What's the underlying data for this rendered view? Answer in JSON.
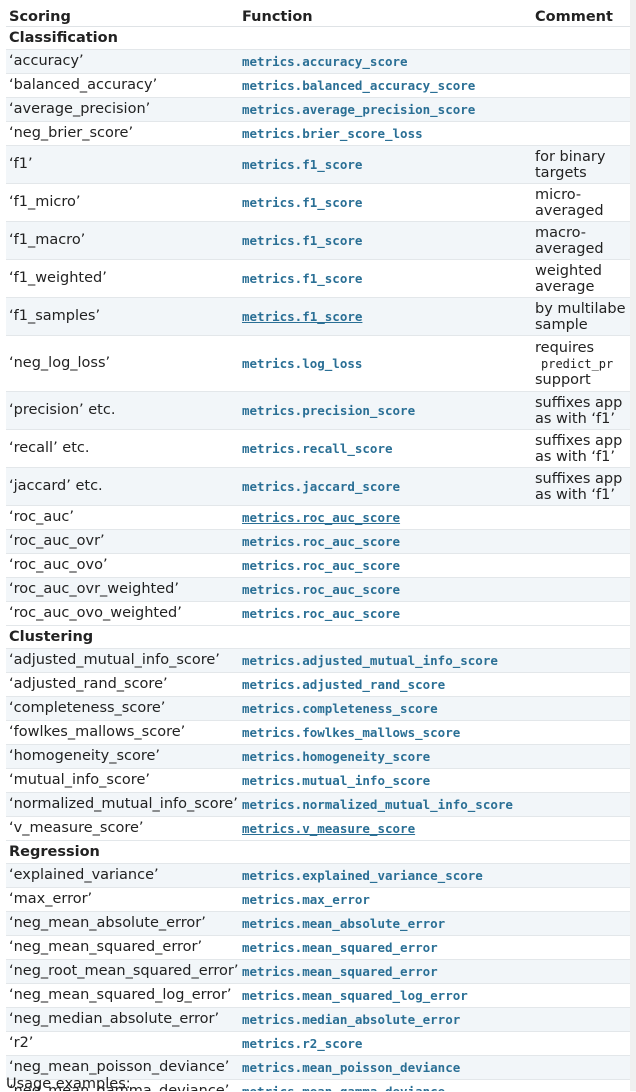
{
  "headers": {
    "scoring": "Scoring",
    "function": "Function",
    "comment": "Comment"
  },
  "sections": [
    {
      "title": "Classification",
      "rows": [
        {
          "scoring": "‘accuracy’",
          "function": "metrics.accuracy_score"
        },
        {
          "scoring": "‘balanced_accuracy’",
          "function": "metrics.balanced_accuracy_score"
        },
        {
          "scoring": "‘average_precision’",
          "function": "metrics.average_precision_score"
        },
        {
          "scoring": "‘neg_brier_score’",
          "function": "metrics.brier_score_loss"
        },
        {
          "scoring": "‘f1’",
          "function": "metrics.f1_score",
          "comment": [
            "for binary",
            "targets"
          ]
        },
        {
          "scoring": "‘f1_micro’",
          "function": "metrics.f1_score",
          "comment": [
            "micro-",
            "averaged"
          ]
        },
        {
          "scoring": "‘f1_macro’",
          "function": "metrics.f1_score",
          "comment": [
            "macro-",
            "averaged"
          ]
        },
        {
          "scoring": "‘f1_weighted’",
          "function": "metrics.f1_score",
          "comment": [
            "weighted",
            "average"
          ]
        },
        {
          "scoring": "‘f1_samples’",
          "function": "metrics.f1_score",
          "comment": [
            "by multilabe",
            "sample"
          ]
        },
        {
          "scoring": "‘neg_log_loss’",
          "function": "metrics.log_loss",
          "comment": [
            "requires",
            "predict_pr",
            "support"
          ]
        },
        {
          "scoring": "‘precision’ etc.",
          "function": "metrics.precision_score",
          "comment": [
            "suffixes app",
            "as with ‘f1’"
          ]
        },
        {
          "scoring": "‘recall’ etc.",
          "function": "metrics.recall_score",
          "comment": [
            "suffixes app",
            "as with ‘f1’"
          ]
        },
        {
          "scoring": "‘jaccard’ etc.",
          "function": "metrics.jaccard_score",
          "comment": [
            "suffixes app",
            "as with ‘f1’"
          ]
        },
        {
          "scoring": "‘roc_auc’",
          "function": "metrics.roc_auc_score"
        },
        {
          "scoring": "‘roc_auc_ovr’",
          "function": "metrics.roc_auc_score"
        },
        {
          "scoring": "‘roc_auc_ovo’",
          "function": "metrics.roc_auc_score"
        },
        {
          "scoring": "‘roc_auc_ovr_weighted’",
          "function": "metrics.roc_auc_score"
        },
        {
          "scoring": "‘roc_auc_ovo_weighted’",
          "function": "metrics.roc_auc_score"
        }
      ]
    },
    {
      "title": "Clustering",
      "rows": [
        {
          "scoring": "‘adjusted_mutual_info_score’",
          "function": "metrics.adjusted_mutual_info_score"
        },
        {
          "scoring": "‘adjusted_rand_score’",
          "function": "metrics.adjusted_rand_score"
        },
        {
          "scoring": "‘completeness_score’",
          "function": "metrics.completeness_score"
        },
        {
          "scoring": "‘fowlkes_mallows_score’",
          "function": "metrics.fowlkes_mallows_score"
        },
        {
          "scoring": "‘homogeneity_score’",
          "function": "metrics.homogeneity_score"
        },
        {
          "scoring": "‘mutual_info_score’",
          "function": "metrics.mutual_info_score"
        },
        {
          "scoring": "‘normalized_mutual_info_score’",
          "function": "metrics.normalized_mutual_info_score"
        },
        {
          "scoring": "‘v_measure_score’",
          "function": "metrics.v_measure_score"
        }
      ]
    },
    {
      "title": "Regression",
      "rows": [
        {
          "scoring": "‘explained_variance’",
          "function": "metrics.explained_variance_score"
        },
        {
          "scoring": "‘max_error’",
          "function": "metrics.max_error"
        },
        {
          "scoring": "‘neg_mean_absolute_error’",
          "function": "metrics.mean_absolute_error"
        },
        {
          "scoring": "‘neg_mean_squared_error’",
          "function": "metrics.mean_squared_error"
        },
        {
          "scoring": "‘neg_root_mean_squared_error’",
          "function": "metrics.mean_squared_error"
        },
        {
          "scoring": "‘neg_mean_squared_log_error’",
          "function": "metrics.mean_squared_log_error"
        },
        {
          "scoring": "‘neg_median_absolute_error’",
          "function": "metrics.median_absolute_error"
        },
        {
          "scoring": "‘r2’",
          "function": "metrics.r2_score"
        },
        {
          "scoring": "‘neg_mean_poisson_deviance’",
          "function": "metrics.mean_poisson_deviance"
        },
        {
          "scoring": "‘neg_mean_gamma_deviance’",
          "function": "metrics.mean_gamma_deviance"
        }
      ]
    }
  ],
  "footer_text": "Usage examples:",
  "colors": {
    "link": "#2a6f95",
    "row_alt": "#f2f6f9",
    "border": "#e3e7ea"
  }
}
